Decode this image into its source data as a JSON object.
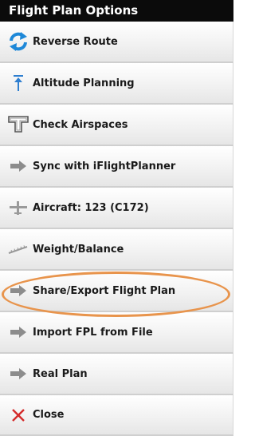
{
  "header": {
    "title": "Flight Plan Options"
  },
  "menu": {
    "items": [
      {
        "label": "Reverse Route",
        "icon": "reverse-arrows-icon"
      },
      {
        "label": "Altitude Planning",
        "icon": "altitude-arrow-icon"
      },
      {
        "label": "Check Airspaces",
        "icon": "airspace-shape-icon"
      },
      {
        "label": "Sync with iFlightPlanner",
        "icon": "arrow-right-icon"
      },
      {
        "label": "Aircraft: 123 (C172)",
        "icon": "airplane-icon"
      },
      {
        "label": "Weight/Balance",
        "icon": "scale-ruler-icon"
      },
      {
        "label": "Share/Export Flight Plan",
        "icon": "arrow-right-icon"
      },
      {
        "label": "Import FPL from File",
        "icon": "arrow-right-icon"
      },
      {
        "label": "Real Plan",
        "icon": "arrow-right-icon"
      },
      {
        "label": "Close",
        "icon": "close-x-icon"
      }
    ]
  },
  "colors": {
    "header_bg": "#0b0b0b",
    "highlight": "#e8944c",
    "close_x": "#d42a2a",
    "reverse": "#1e88d8"
  }
}
